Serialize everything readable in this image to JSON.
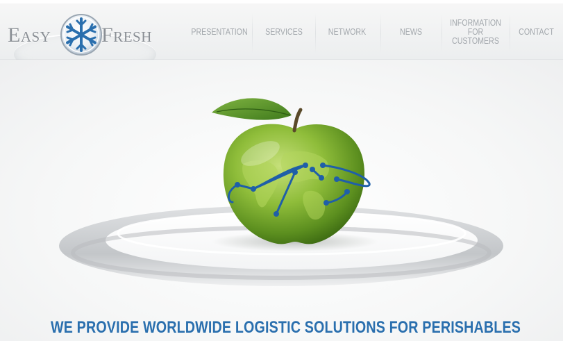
{
  "brand": {
    "name_left": "Easy",
    "name_right": "Fresh",
    "emblem": "snowflake-icon",
    "colors": {
      "primary": "#2a6fae",
      "text_gray": "#8a8f95"
    }
  },
  "nav": {
    "items": [
      {
        "label": "PRESENTATION"
      },
      {
        "label": "SERVICES"
      },
      {
        "label": "NETWORK"
      },
      {
        "label": "NEWS"
      },
      {
        "label_line1": "INFORMATION",
        "label_line2": "FOR CUSTOMERS"
      },
      {
        "label": "CONTACT"
      }
    ]
  },
  "hero": {
    "image": "green-apple-world-map",
    "tagline": "WE PROVIDE WORLDWIDE LOGISTIC SOLUTIONS FOR PERISHABLES"
  }
}
